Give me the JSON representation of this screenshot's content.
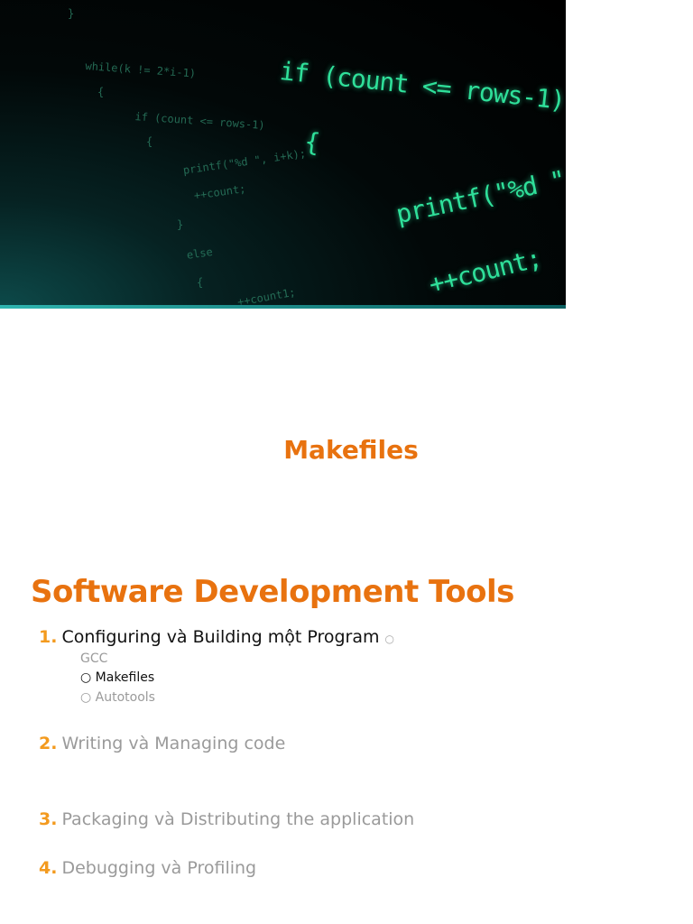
{
  "hero_image": {
    "code_lines_dim": [
      "}",
      "while(k != 2*i-1)",
      "{",
      "if (count <= rows-1)",
      "{",
      "printf(\"%d \", i+k);",
      "++count;",
      "}",
      "else",
      "{",
      "++count1;"
    ],
    "code_lines_bright": [
      "if (count <= rows-1)",
      "{",
      "printf(\"%d \", i+k);",
      "++count;"
    ]
  },
  "section_title": "Makefiles",
  "main_title": "Software Development Tools",
  "outline": [
    {
      "num": "1.",
      "label": "Configuring và Building một Program",
      "bullet": "○",
      "subitems": [
        {
          "label": "GCC"
        },
        {
          "label": "○ Makefiles"
        },
        {
          "label": "○ Autotools"
        }
      ]
    },
    {
      "num": "2.",
      "label": "Writing và Managing code"
    },
    {
      "num": "3.",
      "label": "Packaging và Distributing the application"
    },
    {
      "num": "4.",
      "label": "Debugging và Profiling"
    }
  ],
  "colors": {
    "accent": "#e8720f",
    "number": "#f39a1e",
    "muted": "#9a9a9a"
  }
}
